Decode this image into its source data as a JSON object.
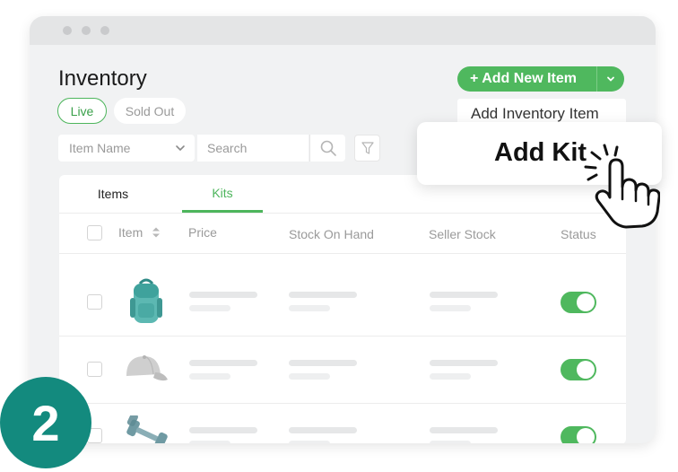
{
  "page": {
    "title": "Inventory"
  },
  "filters": {
    "live_label": "Live",
    "soldout_label": "Sold Out",
    "field_select": "Item Name",
    "search_placeholder": "Search"
  },
  "actions": {
    "add_new_item": "+ Add New Item",
    "menu": [
      "Add Inventory Item",
      "Add Kit"
    ]
  },
  "tabs": [
    {
      "label": "Items",
      "active": false
    },
    {
      "label": "Kits",
      "active": true
    }
  ],
  "table": {
    "columns": [
      "Item",
      "Price",
      "Stock On Hand",
      "Seller Stock",
      "Status"
    ],
    "rows": [
      {
        "item_icon": "backpack-icon",
        "status_on": true
      },
      {
        "item_icon": "cap-icon",
        "status_on": true
      },
      {
        "item_icon": "dumbbell-icon",
        "status_on": true
      }
    ]
  },
  "step": {
    "number": "2"
  },
  "colors": {
    "accent": "#4fb85e",
    "badge": "#138a7e"
  }
}
